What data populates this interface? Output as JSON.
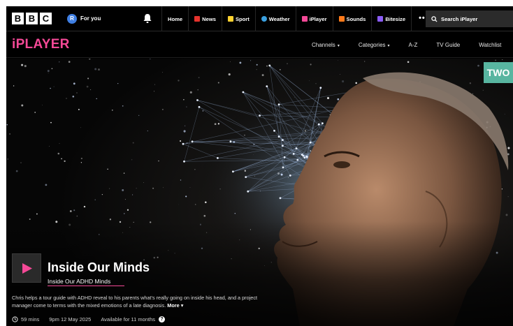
{
  "bbc": {
    "letters": [
      "B",
      "B",
      "C"
    ]
  },
  "account": {
    "initial": "R",
    "label": "For you"
  },
  "nav": {
    "items": [
      {
        "label": "Home",
        "color": ""
      },
      {
        "label": "News",
        "color": "#e5322c"
      },
      {
        "label": "Sport",
        "color": "#ffd230"
      },
      {
        "label": "Weather",
        "color": "#3aa0e0"
      },
      {
        "label": "iPlayer",
        "color": "#f54997"
      },
      {
        "label": "Sounds",
        "color": "#ff7a1a"
      },
      {
        "label": "Bitesize",
        "color": "#8b5cf6"
      }
    ],
    "more": "•••"
  },
  "search": {
    "placeholder": "Search iPlayer"
  },
  "iplayer": {
    "logo": "iPLAYER",
    "logo_color": "#f54997",
    "nav": [
      {
        "label": "Channels",
        "caret": "▾"
      },
      {
        "label": "Categories",
        "caret": "▾"
      },
      {
        "label": "A-Z",
        "caret": ""
      },
      {
        "label": "TV Guide",
        "caret": ""
      },
      {
        "label": "Watchlist",
        "caret": ""
      }
    ]
  },
  "hero": {
    "channel": "TWO",
    "channel_color": "#58b5a0",
    "title": "Inside Our Minds",
    "subtitle": "Inside Our ADHD Minds",
    "description": "Chris helps a tour guide with ADHD reveal to his parents what's really going on inside his head, and a project manager come to terms with the mixed emotions of a late diagnosis.",
    "more_label": "More ▾",
    "duration": "59 mins",
    "broadcast": "9pm 12 May 2025",
    "availability": "Available for 11 months",
    "info_glyph": "?"
  }
}
